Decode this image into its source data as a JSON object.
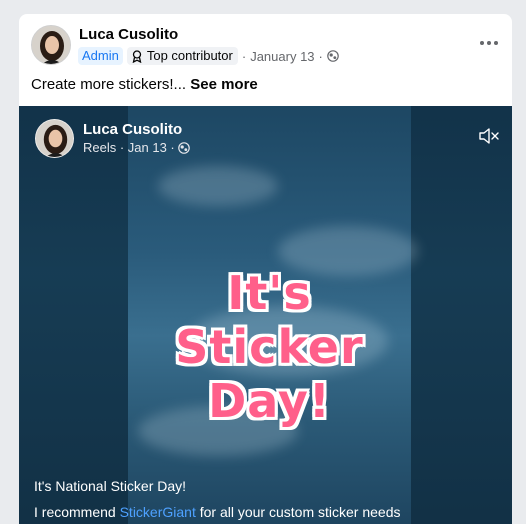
{
  "post": {
    "author": "Luca Cusolito",
    "badge_admin": "Admin",
    "badge_top": "Top contributor",
    "date": "January 13",
    "separator": "·",
    "text": "Create more stickers!...",
    "see_more": "See more"
  },
  "reel": {
    "author": "Luca Cusolito",
    "meta": "Reels · Jan 13 ·",
    "sticker_lines": [
      "It's",
      "Sticker",
      "Day!"
    ],
    "caption_line1": "It's National Sticker Day!",
    "caption_line2_before": "I recommend ",
    "caption_link": "StickerGiant",
    "caption_line2_after": " for all your custom sticker needs"
  },
  "icons": {
    "more": "more-horizontal-icon",
    "top_contributor": "award-icon",
    "audience": "public-globe-icon",
    "mute": "volume-muted-icon"
  },
  "colors": {
    "link_blue": "#1877f2",
    "admin_badge_bg": "#e7f3ff",
    "sticker_pink": "#ff5f8a",
    "caption_link": "#4ea1ff"
  }
}
